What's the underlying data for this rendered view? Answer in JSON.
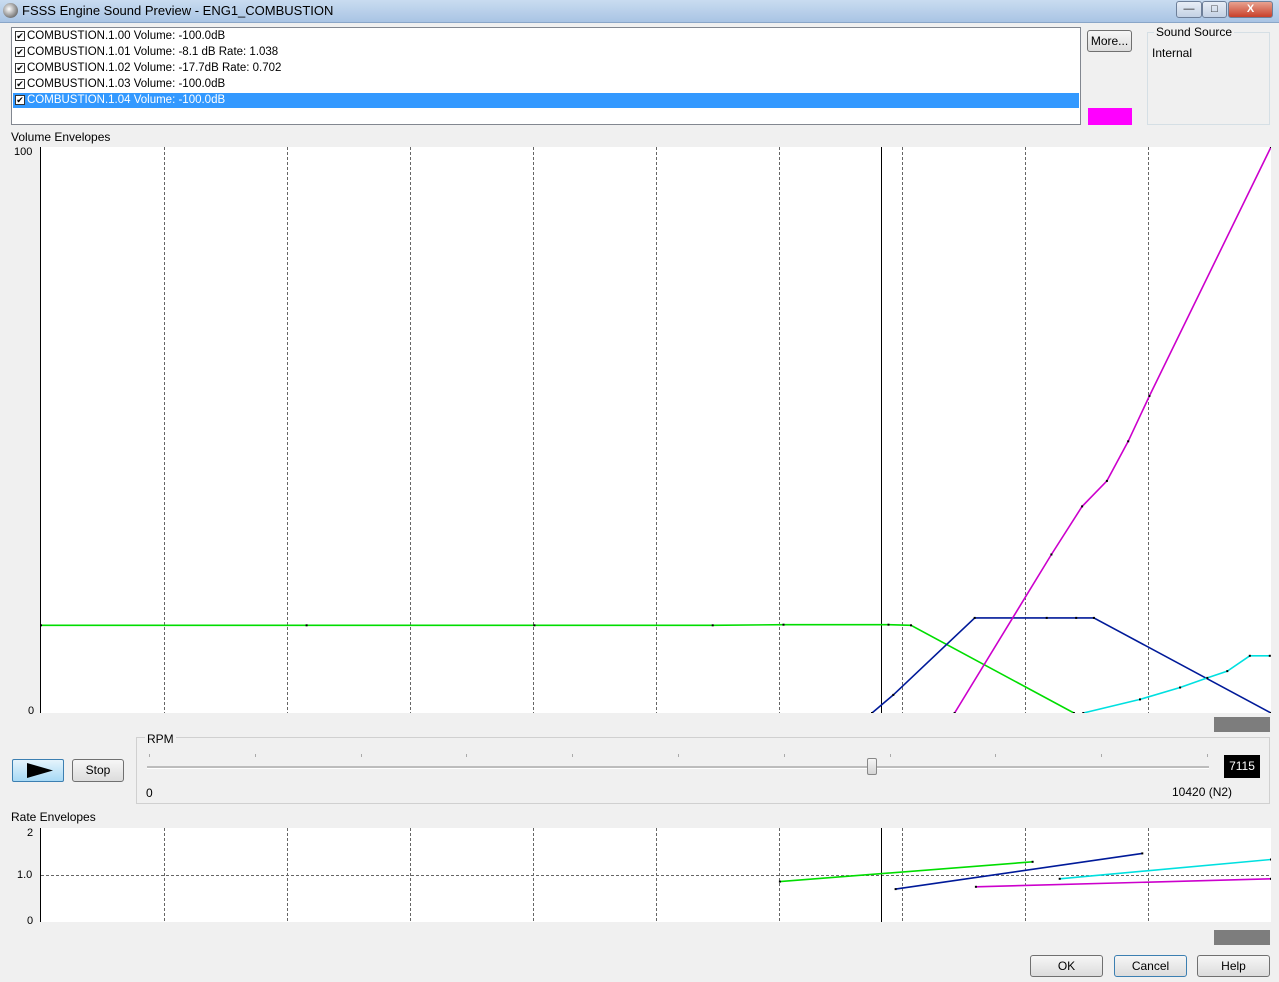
{
  "window": {
    "title": "FSSS Engine Sound Preview - ENG1_COMBUSTION",
    "min_label": "—",
    "max_label": "□",
    "close_label": "X"
  },
  "sounds": [
    {
      "label": "COMBUSTION.1.00 Volume: -100.0dB",
      "checked": true
    },
    {
      "label": "COMBUSTION.1.01 Volume: -8.1 dB  Rate: 1.038",
      "checked": true
    },
    {
      "label": "COMBUSTION.1.02 Volume: -17.7dB  Rate: 0.702",
      "checked": true
    },
    {
      "label": "COMBUSTION.1.03 Volume: -100.0dB",
      "checked": true
    },
    {
      "label": "COMBUSTION.1.04 Volume: -100.0dB",
      "checked": true,
      "selected": true
    }
  ],
  "check_mark": "✔",
  "more_button": "More...",
  "selected_color": "#ff00ff",
  "sound_source": {
    "label": "Sound Source",
    "value": "Internal"
  },
  "volume_panel": {
    "label": "Volume Envelopes",
    "y_max": "100",
    "y_min": "0"
  },
  "rate_panel": {
    "label": "Rate Envelopes",
    "y_ticks": [
      "2",
      "1.0",
      "0"
    ]
  },
  "controls": {
    "stop_label": "Stop",
    "play_icon": "play-icon"
  },
  "rpm": {
    "label": "RPM",
    "min_label": "0",
    "max_label": "10420 (N2)",
    "value_label": "7115",
    "min": 0,
    "max": 10420,
    "value": 7115
  },
  "footer": {
    "ok": "OK",
    "cancel": "Cancel",
    "help": "Help"
  },
  "chart_data": [
    {
      "type": "line",
      "title": "Volume Envelopes",
      "x_range": [
        0,
        10420
      ],
      "y_range": [
        0,
        100
      ],
      "grid": "vertical dashed",
      "cursor_x": 7115,
      "series": [
        {
          "color": "#00dd00",
          "points": [
            [
              0,
              15.5
            ],
            [
              2250,
              15.5
            ],
            [
              4180,
              15.5
            ],
            [
              5690,
              15.5
            ],
            [
              6290,
              15.6
            ],
            [
              7180,
              15.6
            ],
            [
              7370,
              15.5
            ],
            [
              8750,
              0
            ]
          ]
        },
        {
          "color": "#001a99",
          "points": [
            [
              7040,
              0
            ],
            [
              7220,
              3.2
            ],
            [
              7910,
              16.8
            ],
            [
              8520,
              16.8
            ],
            [
              8770,
              16.8
            ],
            [
              8920,
              16.8
            ],
            [
              10420,
              0
            ]
          ]
        },
        {
          "color": "#cc00cc",
          "points": [
            [
              7740,
              0
            ],
            [
              8560,
              28
            ],
            [
              8820,
              36.5
            ],
            [
              9030,
              41
            ],
            [
              9210,
              48
            ],
            [
              9390,
              56
            ],
            [
              10420,
              100
            ]
          ]
        },
        {
          "color": "#00e0e0",
          "points": [
            [
              8830,
              0
            ],
            [
              9310,
              2.4
            ],
            [
              9650,
              4.5
            ],
            [
              9880,
              6.2
            ],
            [
              10050,
              7.4
            ],
            [
              10240,
              10.1
            ],
            [
              10410,
              10.1
            ]
          ]
        }
      ]
    },
    {
      "type": "line",
      "title": "Rate Envelopes",
      "x_range": [
        0,
        10420
      ],
      "y_range": [
        0,
        2
      ],
      "y_ticks": [
        0,
        1.0,
        2
      ],
      "cursor_x": 7115,
      "series": [
        {
          "color": "#00dd00",
          "points": [
            [
              6260,
              0.86
            ],
            [
              8400,
              1.28
            ]
          ]
        },
        {
          "color": "#001a99",
          "points": [
            [
              7240,
              0.7
            ],
            [
              9330,
              1.46
            ]
          ]
        },
        {
          "color": "#cc00cc",
          "points": [
            [
              7920,
              0.75
            ],
            [
              10420,
              0.92
            ]
          ]
        },
        {
          "color": "#00e0e0",
          "points": [
            [
              8630,
              0.92
            ],
            [
              10420,
              1.33
            ]
          ]
        }
      ]
    }
  ]
}
